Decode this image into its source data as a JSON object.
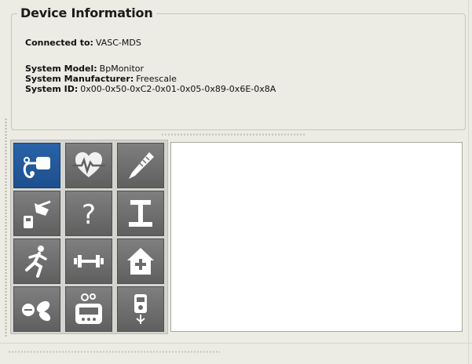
{
  "device_info": {
    "title": "Device Information",
    "connected": {
      "label": "Connected to",
      "value": "VASC-MDS"
    },
    "model": {
      "label": "System Model",
      "value": "BpMonitor"
    },
    "manufacturer": {
      "label": "System Manufacturer",
      "value": "Freescale"
    },
    "system_id": {
      "label": "System ID",
      "value": "0x00-0x50-0xC2-0x01-0x05-0x89-0x6E-0x8A"
    }
  },
  "icon_grid": {
    "tiles": [
      {
        "icon": "blood-pressure-icon",
        "selected": true
      },
      {
        "icon": "heart-rate-icon",
        "selected": false
      },
      {
        "icon": "thermometer-icon",
        "selected": false
      },
      {
        "icon": "glucose-hand-icon",
        "selected": false
      },
      {
        "icon": "question-icon",
        "selected": false
      },
      {
        "icon": "weighing-scale-icon",
        "selected": false
      },
      {
        "icon": "running-person-icon",
        "selected": false
      },
      {
        "icon": "dumbbell-icon",
        "selected": false
      },
      {
        "icon": "home-health-icon",
        "selected": false
      },
      {
        "icon": "pills-icon",
        "selected": false
      },
      {
        "icon": "pump-device-icon",
        "selected": false
      },
      {
        "icon": "inhaler-monitor-icon",
        "selected": false
      }
    ]
  },
  "colors": {
    "window_bg": "#ecebe4",
    "tile_bg": "#6f6f6f",
    "tile_selected": "#2a63a8",
    "icon_fg": "#ffffff"
  }
}
